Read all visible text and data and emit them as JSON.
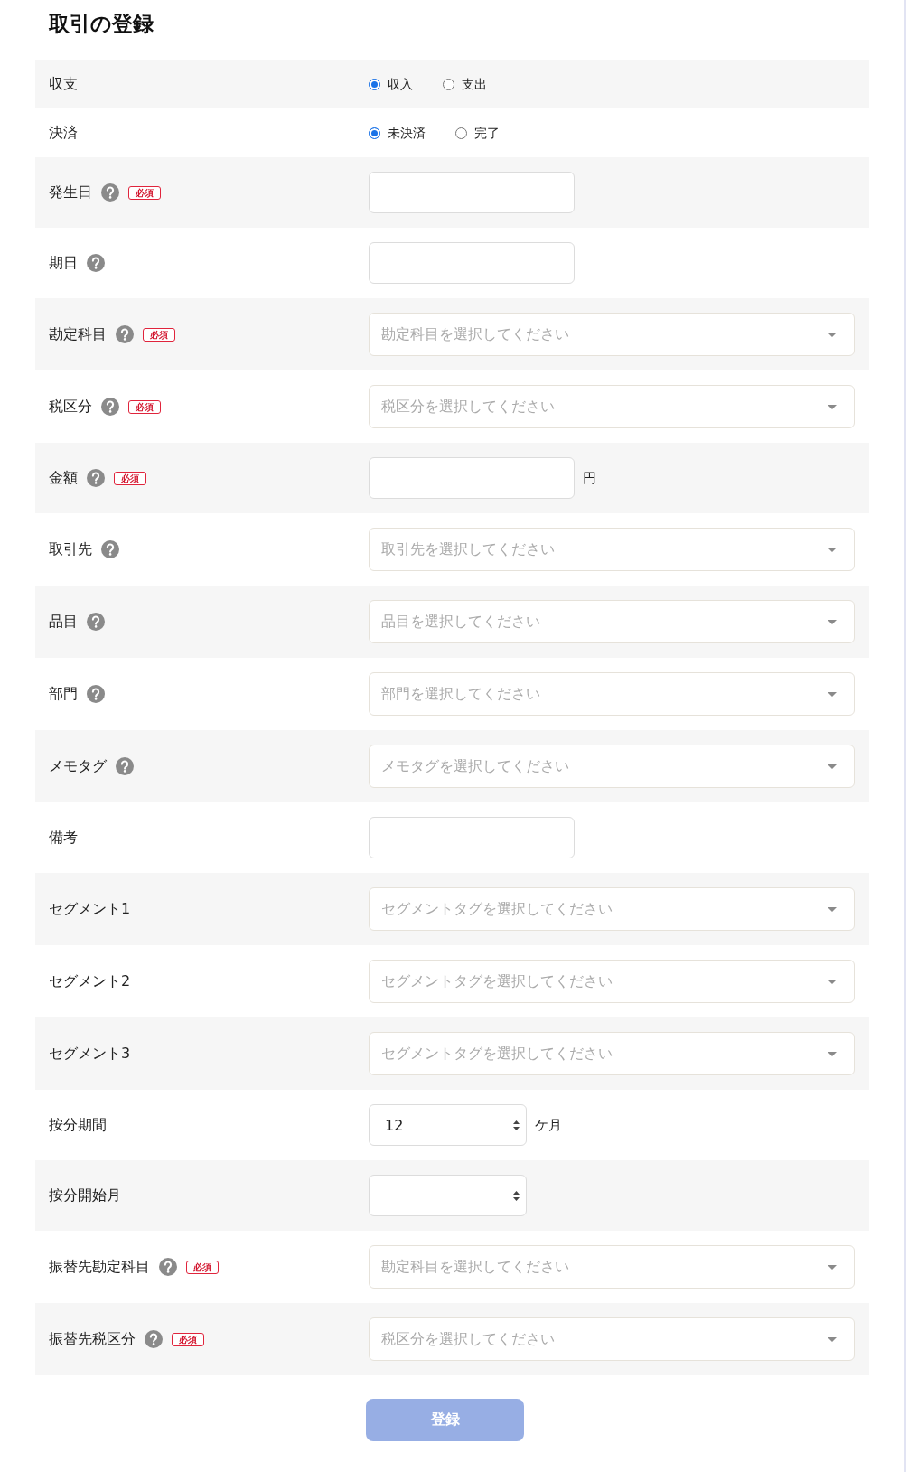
{
  "title": "取引の登録",
  "rows": [
    {
      "label": "収支",
      "help": false,
      "kind": "radio",
      "options": [
        {
          "label": "収入",
          "selected": true
        },
        {
          "label": "支出",
          "selected": false
        }
      ]
    },
    {
      "label": "決済",
      "help": false,
      "kind": "radio",
      "options": [
        {
          "label": "未決済",
          "selected": true
        },
        {
          "label": "完了",
          "selected": false
        }
      ]
    },
    {
      "label": "発生日",
      "help": true,
      "badge": "必須",
      "kind": "input"
    },
    {
      "label": "期日",
      "help": true,
      "kind": "input"
    },
    {
      "label": "勘定科目",
      "help": true,
      "badge": "必須",
      "kind": "select",
      "placeholder": "勘定科目を選択してください"
    },
    {
      "label": "税区分",
      "help": true,
      "badge": "必須",
      "kind": "select",
      "placeholder": "税区分を選択してください"
    },
    {
      "label": "金額",
      "help": true,
      "badge": "必須",
      "kind": "input",
      "unit": "円"
    },
    {
      "label": "取引先",
      "help": true,
      "kind": "select",
      "placeholder": "取引先を選択してください"
    },
    {
      "label": "品目",
      "help": true,
      "kind": "select",
      "placeholder": "品目を選択してください"
    },
    {
      "label": "部門",
      "help": true,
      "kind": "select",
      "placeholder": "部門を選択してください"
    },
    {
      "label": "メモタグ",
      "help": true,
      "kind": "select",
      "placeholder": "メモタグを選択してください"
    },
    {
      "label": "備考",
      "help": false,
      "kind": "input"
    },
    {
      "label": "セグメント1",
      "help": false,
      "kind": "select",
      "placeholder": "セグメントタグを選択してください"
    },
    {
      "label": "セグメント2",
      "help": false,
      "kind": "select",
      "placeholder": "セグメントタグを選択してください"
    },
    {
      "label": "セグメント3",
      "help": false,
      "kind": "select",
      "placeholder": "セグメントタグを選択してください"
    },
    {
      "label": "按分期間",
      "help": false,
      "kind": "picker",
      "value": "12",
      "unit": "ケ月"
    },
    {
      "label": "按分開始月",
      "help": false,
      "kind": "picker"
    },
    {
      "label": "振替先勘定科目",
      "help": true,
      "badge": "必須",
      "kind": "select",
      "placeholder": "勘定科目を選択してください"
    },
    {
      "label": "振替先税区分",
      "help": true,
      "badge": "必須",
      "kind": "select",
      "placeholder": "税区分を選択してください"
    }
  ],
  "submit": {
    "label": "登録",
    "disabled": true
  }
}
